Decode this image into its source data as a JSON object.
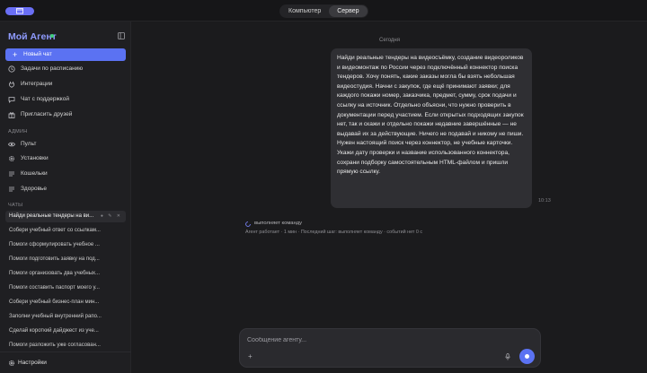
{
  "topbar": {
    "modes": [
      "Компьютер",
      "Сервер"
    ],
    "active_mode": "Сервер",
    "accent": "#6a6ff5"
  },
  "sidebar": {
    "brand": "Мой Агент",
    "new_chat": "Новый чат",
    "nav": [
      {
        "label": "Задачи по расписанию",
        "icon": "clock-icon"
      },
      {
        "label": "Интеграции",
        "icon": "plug-icon"
      },
      {
        "label": "Чат с поддержкой",
        "icon": "chat-icon"
      },
      {
        "label": "Пригласить друзей",
        "icon": "gift-icon"
      }
    ],
    "admin_label": "АДМИН",
    "admin": [
      {
        "label": "Пульт",
        "icon": "eye-icon"
      },
      {
        "label": "Установки",
        "icon": "gear-icon"
      },
      {
        "label": "Кошельки",
        "icon": "list-icon"
      },
      {
        "label": "Здоровье",
        "icon": "list-icon"
      }
    ],
    "chats_label": "ЧАТЫ",
    "chats": [
      "Найди реальные тендеры на ви...",
      "Собери учебный ответ со ссылкам...",
      "Помоги сформулировать учебное ...",
      "Помоги подготовить заявку на под...",
      "Помоги организовать два учебных...",
      "Помоги составить паспорт моего у...",
      "Собери учебный бизнес-план мин...",
      "Заполни учебный внутренний рапо...",
      "Сделай короткий дайджест из уче...",
      "Помоги разложить уже согласован..."
    ],
    "settings": "Настройки"
  },
  "main": {
    "day": "Сегодня",
    "message": "Найди реальные тендеры на видеосъёмку, создание видеороликов и видеомонтаж по России через подключённый коннектор поиска тендеров. Хочу понять, какие заказы могла бы взять небольшая видеостудия. Начни с закупок, где ещё принимают заявки; для каждого покажи номер, заказчика, предмет, сумму, срок подачи и ссылку на источник. Отдельно объясни, что нужно проверить в документации перед участием. Если открытых подходящих закупок нет, так и скажи и отдельно покажи недавние завершённые — не выдавай их за действующие. Ничего не подавай и никому не пиши. Нужен настоящий поиск через коннектор, не учебные карточки. Укажи дату проверки и название использованного коннектора, сохрани подборку самостоятельным HTML-файлом и пришли прямую ссылку.",
    "time": "10:13",
    "working": "выполняет команду",
    "status": "Агент работает · 1 мин · Последний шаг: выполняет команду · событий нет 0 с",
    "composer_placeholder": "Сообщение агенту..."
  }
}
